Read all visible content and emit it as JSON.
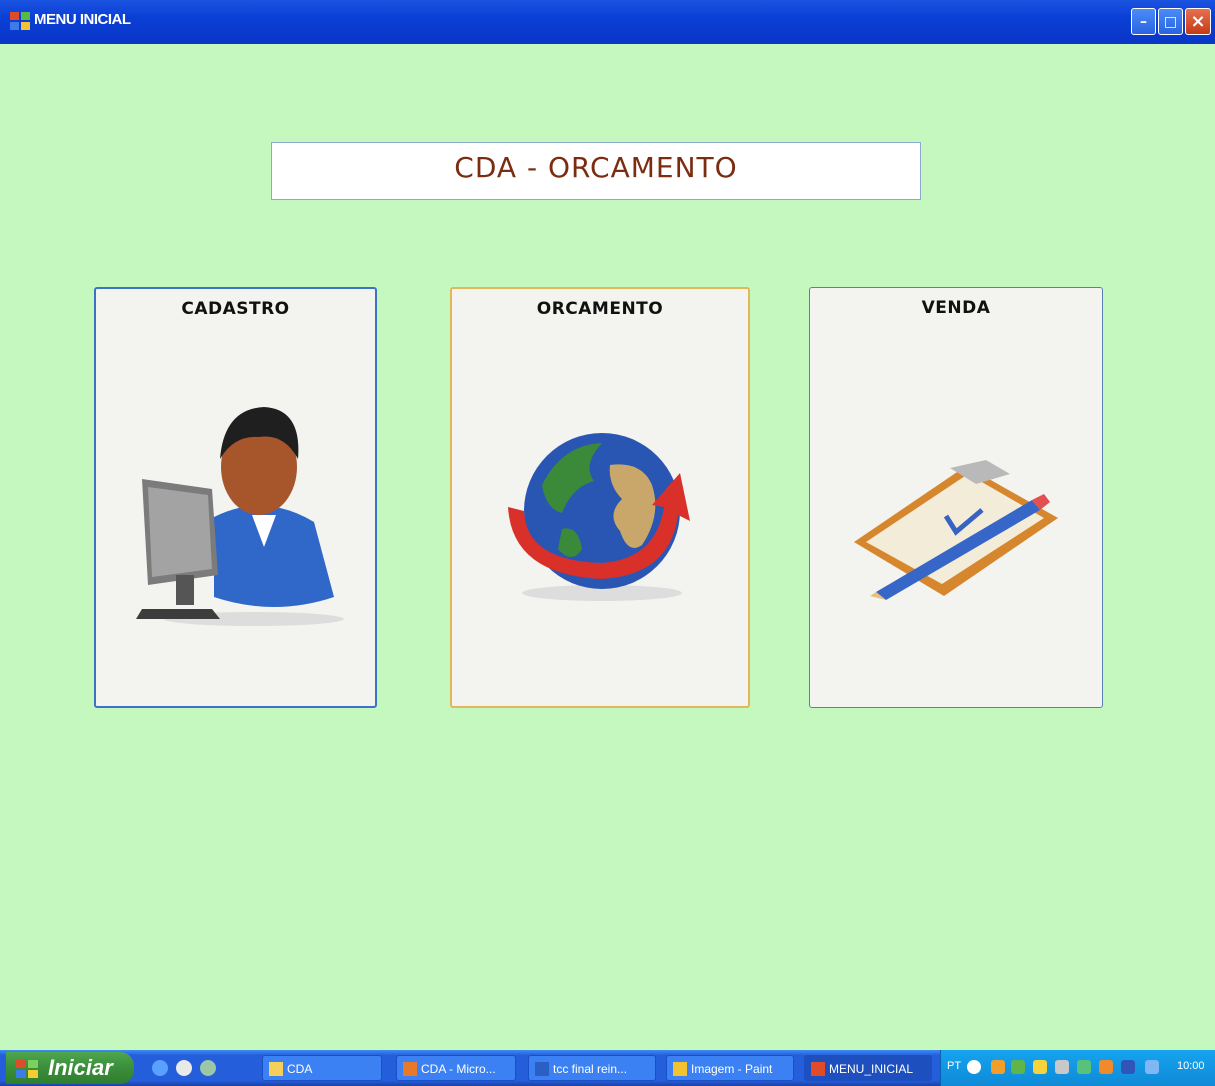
{
  "window": {
    "title": "MENU INICIAL",
    "minimize": "–",
    "maximize": "□",
    "close": "×"
  },
  "banner": {
    "text": "CDA - ORCAMENTO"
  },
  "cards": {
    "cadastro": {
      "label": "CADASTRO",
      "icon": "user-computer-icon"
    },
    "orcamento": {
      "label": "ORCAMENTO",
      "icon": "globe-icon"
    },
    "venda": {
      "label": "VENDA",
      "icon": "clipboard-icon"
    }
  },
  "taskbar": {
    "start_label": "Iniciar",
    "items": [
      "CDA",
      "CDA - Micro...",
      "tcc final rein...",
      "Imagem - Paint",
      "MENU_INICIAL"
    ],
    "tray": {
      "lang": "PT",
      "clock": "10:00"
    }
  },
  "colors": {
    "background": "#c4f8bf",
    "titlebar": "#0a3fd6",
    "banner_text": "#7a2d10"
  }
}
